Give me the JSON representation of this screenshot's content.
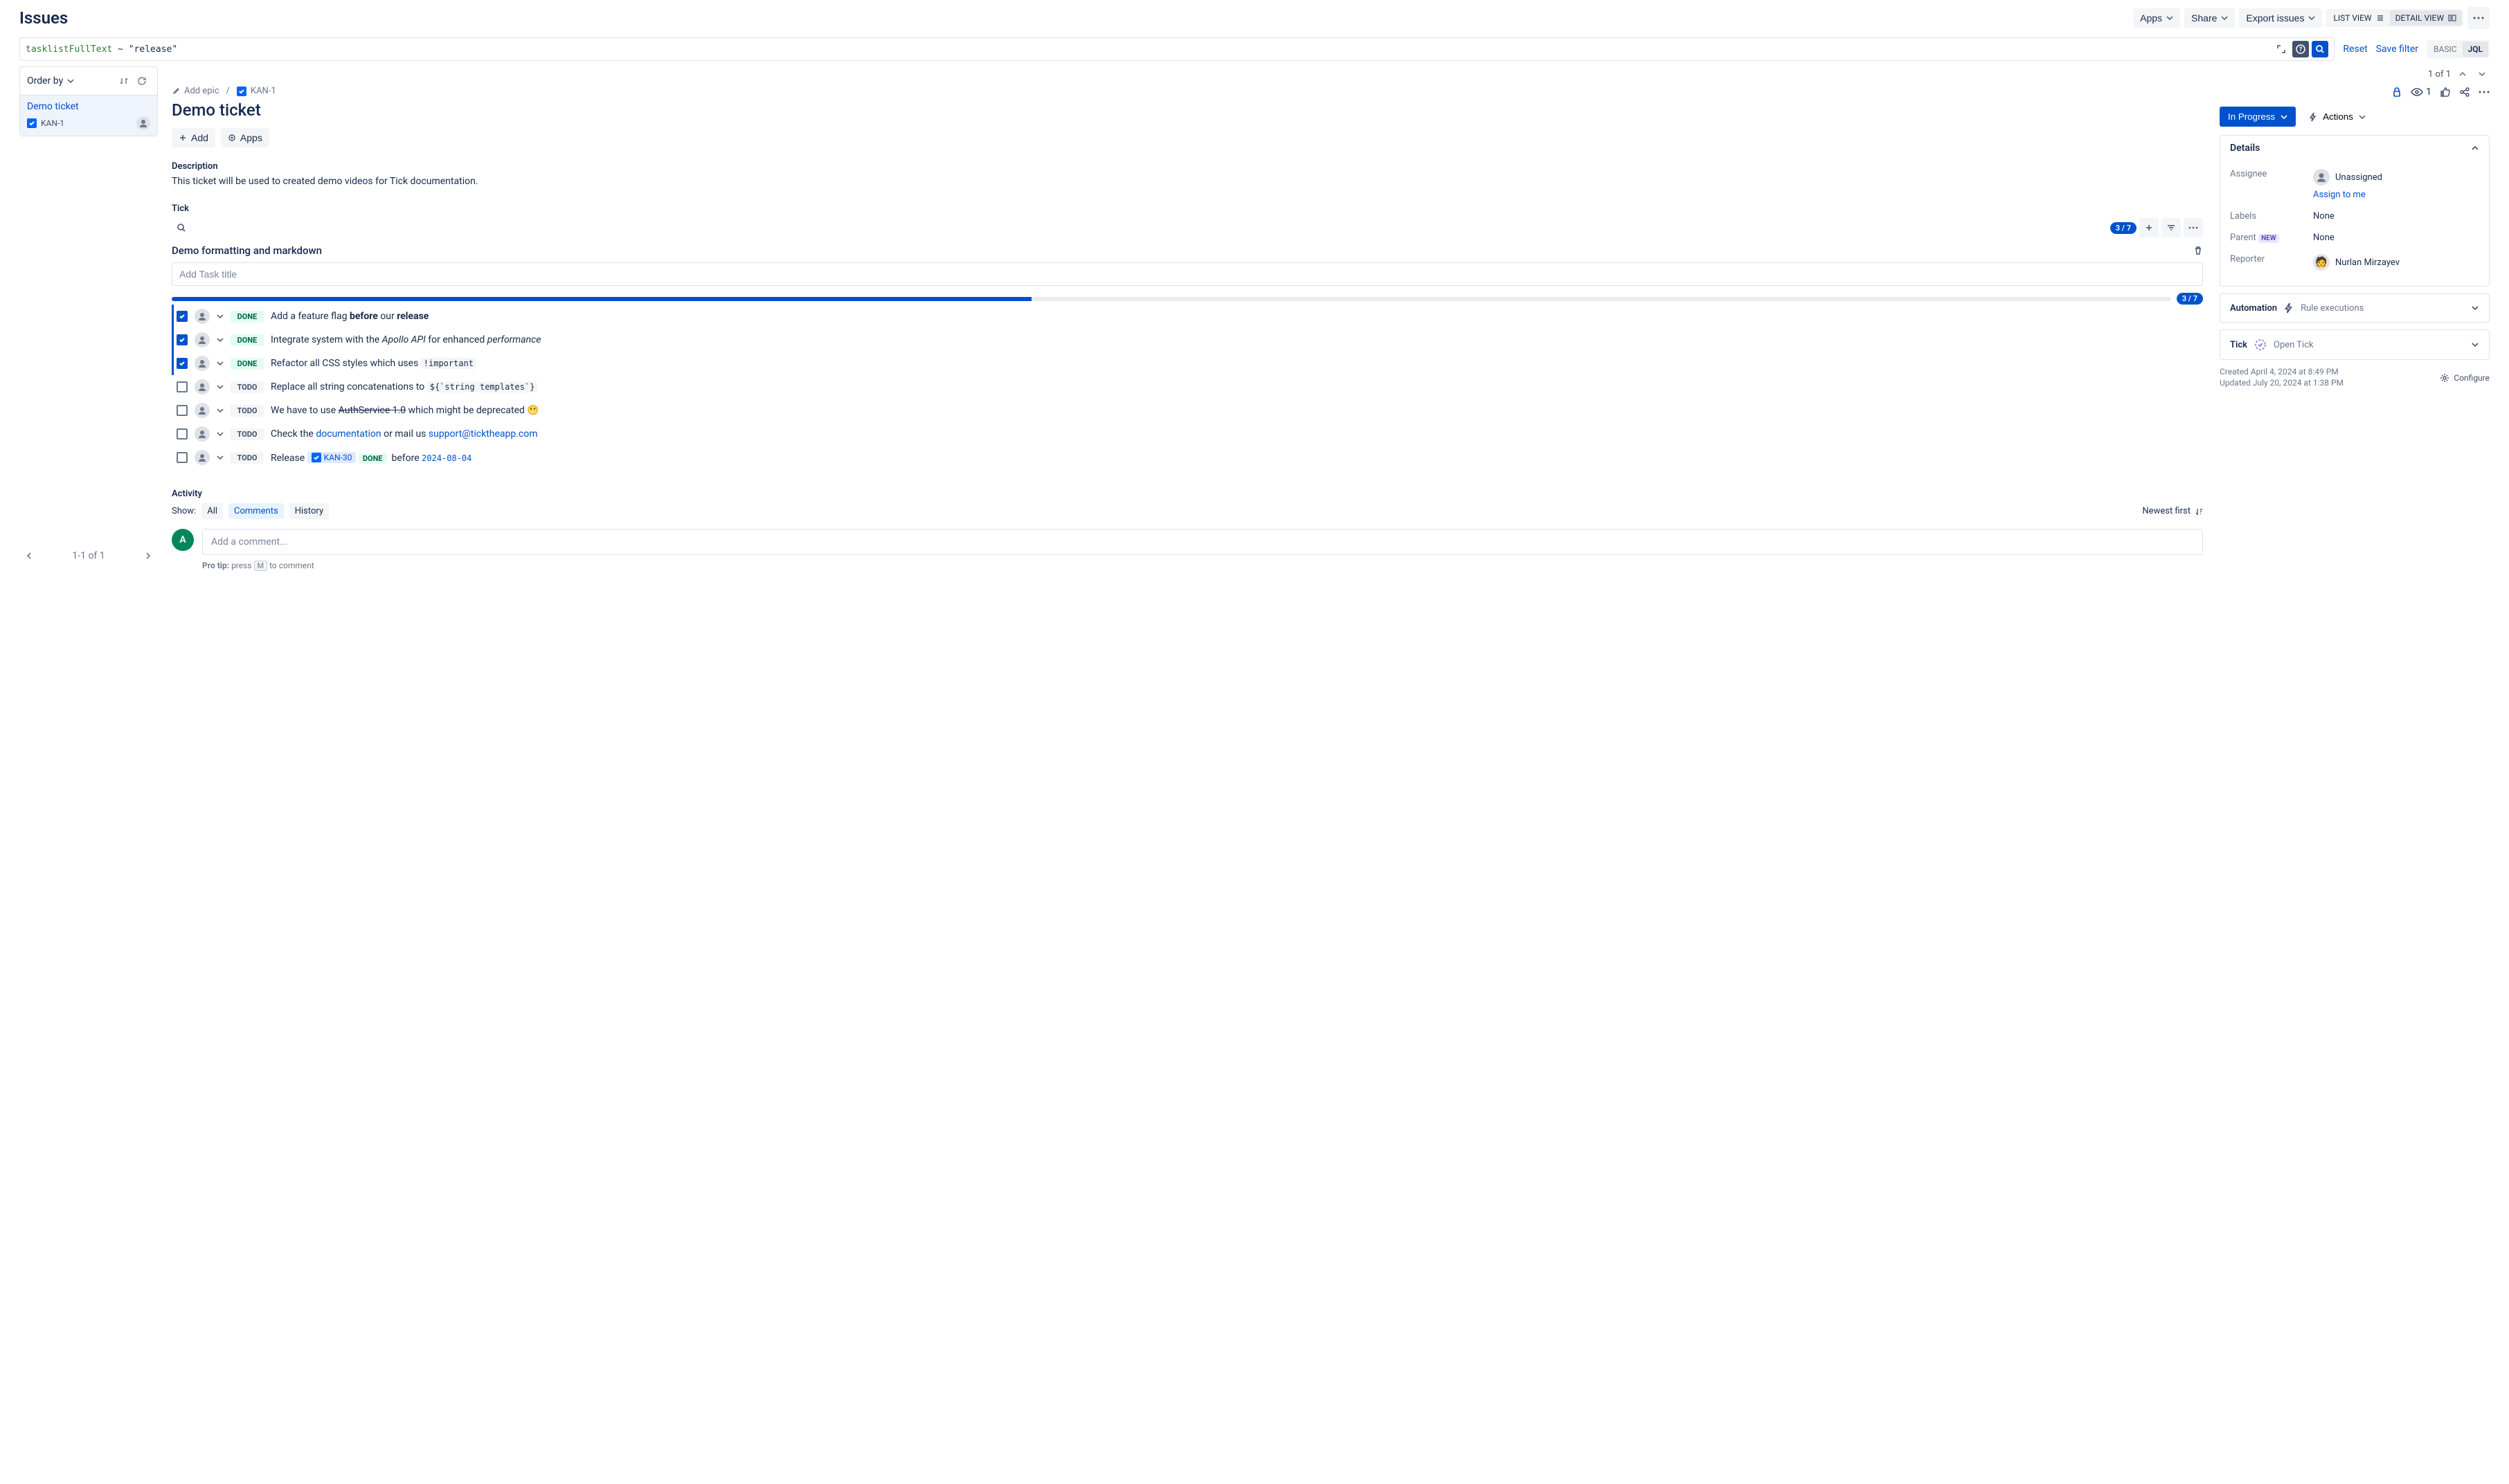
{
  "header": {
    "title": "Issues",
    "apps": "Apps",
    "share": "Share",
    "export": "Export issues",
    "list_view": "LIST VIEW",
    "detail_view": "DETAIL VIEW"
  },
  "jql": {
    "func": "tasklistFullText",
    "rest": " ~ \"release\"",
    "reset": "Reset",
    "save": "Save filter",
    "basic": "BASIC",
    "jql": "JQL"
  },
  "sidebar": {
    "orderby": "Order by",
    "item_title": "Demo ticket",
    "item_key": "KAN-1",
    "footer": "1-1 of 1"
  },
  "counter": {
    "text": "1 of 1"
  },
  "crumbs": {
    "add_epic": "Add epic",
    "issue_key": "KAN-1",
    "watchers": "1"
  },
  "issue": {
    "title": "Demo ticket",
    "add": "Add",
    "apps": "Apps",
    "desc_label": "Description",
    "desc_text": "This ticket will be used to created demo videos for Tick documentation."
  },
  "tick": {
    "label": "Tick",
    "count": "3 / 7",
    "section_name": "Demo formatting and markdown",
    "add_placeholder": "Add Task title",
    "progress": "3 / 7",
    "progress_pct": 43,
    "tasks": [
      {
        "done": true,
        "status": "DONE",
        "html": "Add a feature flag <b>before</b> our <b>release</b>"
      },
      {
        "done": true,
        "status": "DONE",
        "html": "Integrate system with the <i>Apollo API</i> for enhanced <i>performance</i>"
      },
      {
        "done": true,
        "status": "DONE",
        "html": "Refactor all CSS styles which uses <code>!important</code>"
      },
      {
        "done": false,
        "status": "TODO",
        "html": "Replace all string concatenations to <code>${`string templates`}</code>"
      },
      {
        "done": false,
        "status": "TODO",
        "html": "We have to use <s>AuthService 1.0</s> which might be deprecated 😬"
      },
      {
        "done": false,
        "status": "TODO",
        "html": "Check the <a class='link'>documentation</a> or mail us <a class='link'>support@ticktheapp.com</a>"
      },
      {
        "done": false,
        "status": "TODO",
        "html": "Release <span class='inline-badge'><span class='typeicon'><svg viewBox=\"0 0 10 10\"><path d=\"M2 5l2 2 4-4\" stroke=\"#fff\" stroke-width=\"2\" fill=\"none\"/></svg></span> KAN-30</span> <span class='lozenge-done'>DONE</span> &nbsp;before <span class='datecode'>2024-08-04</span>"
      }
    ]
  },
  "activity": {
    "label": "Activity",
    "show": "Show:",
    "all": "All",
    "comments": "Comments",
    "history": "History",
    "sort": "Newest first",
    "placeholder": "Add a comment...",
    "avatar_letter": "A",
    "protip_label": "Pro tip:",
    "protip_press": "press",
    "protip_key": "M",
    "protip_rest": "to comment"
  },
  "right": {
    "status": "In Progress",
    "actions": "Actions",
    "details": "Details",
    "assignee_label": "Assignee",
    "assignee_value": "Unassigned",
    "assign_to_me": "Assign to me",
    "labels_label": "Labels",
    "labels_value": "None",
    "parent_label": "Parent",
    "parent_new": "NEW",
    "parent_value": "None",
    "reporter_label": "Reporter",
    "reporter_value": "Nurlan Mirzayev",
    "automation": "Automation",
    "rule_exec": "Rule executions",
    "tick": "Tick",
    "open_tick": "Open Tick",
    "created": "Created April 4, 2024 at 8:49 PM",
    "updated": "Updated July 20, 2024 at 1:38 PM",
    "configure": "Configure"
  }
}
